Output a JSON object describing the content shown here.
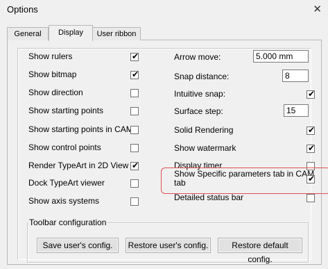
{
  "window": {
    "title": "Options",
    "close_glyph": "✕"
  },
  "tabs": [
    {
      "label": "General"
    },
    {
      "label": "Display"
    },
    {
      "label": "User ribbon"
    }
  ],
  "left_options": [
    {
      "label": "Show rulers",
      "checked": true
    },
    {
      "label": "Show bitmap",
      "checked": true
    },
    {
      "label": "Show direction",
      "checked": false
    },
    {
      "label": "Show starting points",
      "checked": false
    },
    {
      "label": "Show starting points in CAM ta",
      "checked": false
    },
    {
      "label": "Show control points",
      "checked": false
    },
    {
      "label": "Render TypeArt in 2D View",
      "checked": true
    },
    {
      "label": "Dock TypeArt viewer",
      "checked": false
    },
    {
      "label": "Show axis systems",
      "checked": false
    }
  ],
  "fields": {
    "arrow_move": {
      "label": "Arrow move:",
      "value": "5.000 mm"
    },
    "snap_distance": {
      "label": "Snap distance:",
      "value": "8"
    },
    "surface_step": {
      "label": "Surface step:",
      "value": "15"
    }
  },
  "right_options": {
    "intuitive_snap": {
      "label": "Intuitive snap:",
      "checked": true
    },
    "solid_rendering": {
      "label": "Solid Rendering",
      "checked": true
    },
    "show_watermark": {
      "label": "Show watermark",
      "checked": true
    },
    "display_timer": {
      "label": "Display timer",
      "checked": false
    },
    "specific_params": {
      "label_line1": "Show Specific parameters tab in CAM",
      "label_line2": "tab",
      "checked": true
    },
    "detailed_status": {
      "label": "Detailed status bar",
      "checked": false
    }
  },
  "toolbar": {
    "group_label": "Toolbar configuration",
    "save_label": "Save user's config.",
    "restore_user_label": "Restore user's config.",
    "restore_default_label": "Restore default config."
  },
  "check_glyph": "✔",
  "highlight_color": "#e05252"
}
